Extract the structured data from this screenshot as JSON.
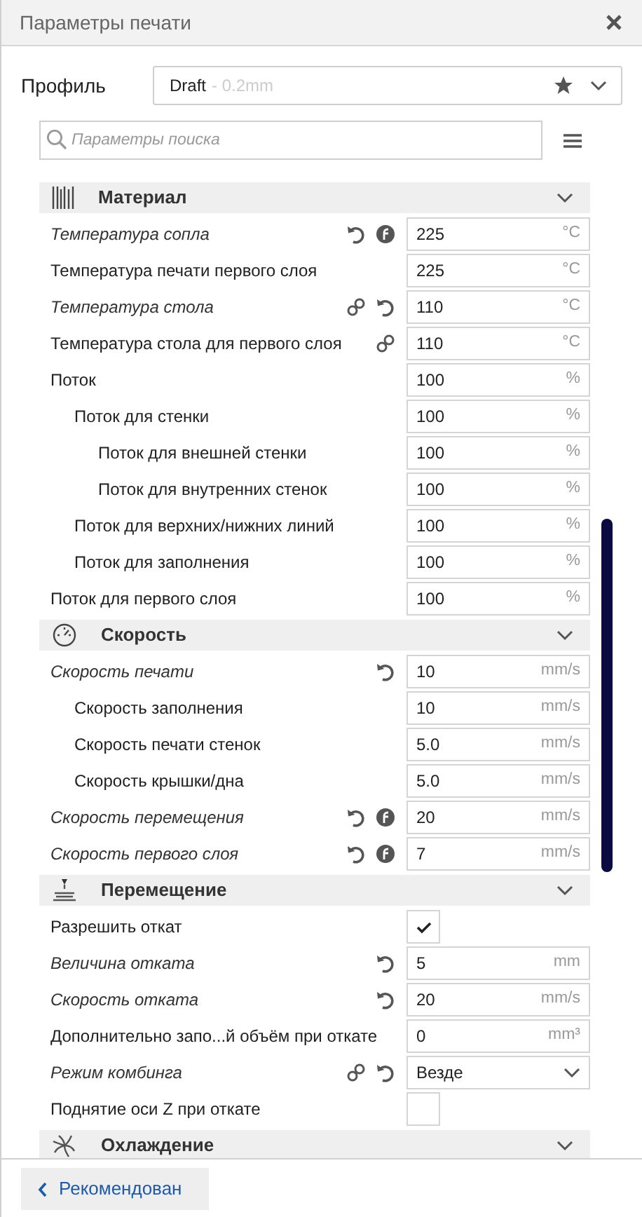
{
  "window": {
    "title": "Параметры печати"
  },
  "profile": {
    "label": "Профиль",
    "name": "Draft",
    "suffix": "- 0.2mm"
  },
  "search": {
    "placeholder": "Параметры поиска"
  },
  "categories": [
    {
      "title": "Материал",
      "kind": "material",
      "settings": [
        {
          "label": "Температура сопла",
          "overridden": true,
          "linked": false,
          "resettable": true,
          "inherits": true,
          "kind": "number",
          "value": "225",
          "unit": "°C"
        },
        {
          "label": "Температура печати первого слоя",
          "overridden": false,
          "linked": false,
          "resettable": false,
          "inherits": false,
          "kind": "number",
          "value": "225",
          "unit": "°C"
        },
        {
          "label": "Температура стола",
          "overridden": true,
          "linked": true,
          "resettable": true,
          "inherits": false,
          "kind": "number",
          "value": "110",
          "unit": "°C"
        },
        {
          "label": "Температура стола для первого слоя",
          "overridden": false,
          "linked": true,
          "resettable": false,
          "inherits": false,
          "kind": "number",
          "value": "110",
          "unit": "°C"
        },
        {
          "label": "Поток",
          "overridden": false,
          "linked": false,
          "resettable": false,
          "inherits": false,
          "kind": "number",
          "value": "100",
          "unit": "%",
          "children": [
            {
              "label": "Поток для стенки",
              "overridden": false,
              "linked": false,
              "resettable": false,
              "inherits": false,
              "kind": "number",
              "value": "100",
              "unit": "%",
              "children": [
                {
                  "label": "Поток для внешней стенки",
                  "overridden": false,
                  "linked": false,
                  "resettable": false,
                  "inherits": false,
                  "kind": "number",
                  "value": "100",
                  "unit": "%"
                },
                {
                  "label": "Поток для внутренних стенок",
                  "overridden": false,
                  "linked": false,
                  "resettable": false,
                  "inherits": false,
                  "kind": "number",
                  "value": "100",
                  "unit": "%"
                }
              ]
            },
            {
              "label": "Поток для верхних/нижних линий",
              "overridden": false,
              "linked": false,
              "resettable": false,
              "inherits": false,
              "kind": "number",
              "value": "100",
              "unit": "%"
            },
            {
              "label": "Поток для заполнения",
              "overridden": false,
              "linked": false,
              "resettable": false,
              "inherits": false,
              "kind": "number",
              "value": "100",
              "unit": "%"
            }
          ]
        },
        {
          "label": "Поток для первого слоя",
          "overridden": false,
          "linked": false,
          "resettable": false,
          "inherits": false,
          "kind": "number",
          "value": "100",
          "unit": "%"
        }
      ]
    },
    {
      "title": "Скорость",
      "kind": "speed",
      "settings": [
        {
          "label": "Скорость печати",
          "overridden": true,
          "linked": false,
          "resettable": true,
          "inherits": false,
          "kind": "number",
          "value": "10",
          "unit": "mm/s",
          "children": [
            {
              "label": "Скорость заполнения",
              "overridden": false,
              "linked": false,
              "resettable": false,
              "inherits": false,
              "kind": "number",
              "value": "10",
              "unit": "mm/s"
            },
            {
              "label": "Скорость печати стенок",
              "overridden": false,
              "linked": false,
              "resettable": false,
              "inherits": false,
              "kind": "number",
              "value": "5.0",
              "unit": "mm/s"
            },
            {
              "label": "Скорость крышки/дна",
              "overridden": false,
              "linked": false,
              "resettable": false,
              "inherits": false,
              "kind": "number",
              "value": "5.0",
              "unit": "mm/s"
            }
          ]
        },
        {
          "label": "Скорость перемещения",
          "overridden": true,
          "linked": false,
          "resettable": true,
          "inherits": true,
          "kind": "number",
          "value": "20",
          "unit": "mm/s"
        },
        {
          "label": "Скорость первого слоя",
          "overridden": true,
          "linked": false,
          "resettable": true,
          "inherits": true,
          "kind": "number",
          "value": "7",
          "unit": "mm/s"
        }
      ]
    },
    {
      "title": "Перемещение",
      "kind": "travel",
      "settings": [
        {
          "label": "Разрешить откат",
          "overridden": false,
          "linked": false,
          "resettable": false,
          "inherits": false,
          "kind": "checkbox",
          "checked": true
        },
        {
          "label": "Величина отката",
          "overridden": true,
          "linked": false,
          "resettable": true,
          "inherits": false,
          "kind": "number",
          "value": "5",
          "unit": "mm"
        },
        {
          "label": "Скорость отката",
          "overridden": true,
          "linked": false,
          "resettable": true,
          "inherits": false,
          "kind": "number",
          "value": "20",
          "unit": "mm/s"
        },
        {
          "label": "Дополнительно запо...й объём при откате",
          "overridden": false,
          "linked": false,
          "resettable": false,
          "inherits": false,
          "kind": "number",
          "value": "0",
          "unit": "mm³"
        },
        {
          "label": "Режим комбинга",
          "overridden": true,
          "linked": true,
          "resettable": true,
          "inherits": false,
          "kind": "select",
          "value": "Везде"
        },
        {
          "label": "Поднятие оси Z при откате",
          "overridden": false,
          "linked": false,
          "resettable": false,
          "inherits": false,
          "kind": "checkbox",
          "checked": false
        }
      ]
    },
    {
      "title": "Охлаждение",
      "kind": "cooling"
    }
  ],
  "footer_button": {
    "label": "Рекомендован"
  }
}
